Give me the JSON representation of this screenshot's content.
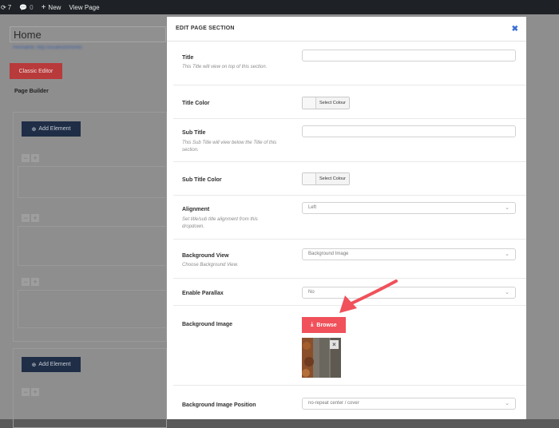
{
  "admin_bar": {
    "updates_count": "7",
    "comments_count": "0",
    "new_label": "New",
    "view_page_label": "View Page"
  },
  "page": {
    "title_value": "Home",
    "permalink_text": "Permalink: http://localhost/home/",
    "classic_editor_label": "Classic Editor",
    "page_builder_label": "Page Builder",
    "add_element_label": "Add Element"
  },
  "modal": {
    "title": "EDIT PAGE SECTION",
    "close_glyph": "✖",
    "fields": {
      "title": {
        "label": "Title",
        "desc": "This Title will view on top of this section.",
        "value": ""
      },
      "title_color": {
        "label": "Title Color",
        "button": "Select Colour"
      },
      "sub_title": {
        "label": "Sub Title",
        "desc": "This Sub Title will view below the Title of this section.",
        "value": ""
      },
      "sub_title_color": {
        "label": "Sub Title Color",
        "button": "Select Colour"
      },
      "alignment": {
        "label": "Alignment",
        "desc": "Set title/sub title alignment from this dropdown.",
        "selected": "Left"
      },
      "background_view": {
        "label": "Background View",
        "desc": "Choose Background View.",
        "selected": "Background Image"
      },
      "enable_parallax": {
        "label": "Enable Parallax",
        "selected": "No"
      },
      "background_image": {
        "label": "Background Image",
        "button": "Browse"
      },
      "background_image_position": {
        "label": "Background Image Position",
        "selected": "no-repeat center / cover"
      }
    }
  },
  "colors": {
    "accent_red": "#f0515a",
    "navy_button": "#1f2e46",
    "close_blue": "#3d6fd6"
  }
}
